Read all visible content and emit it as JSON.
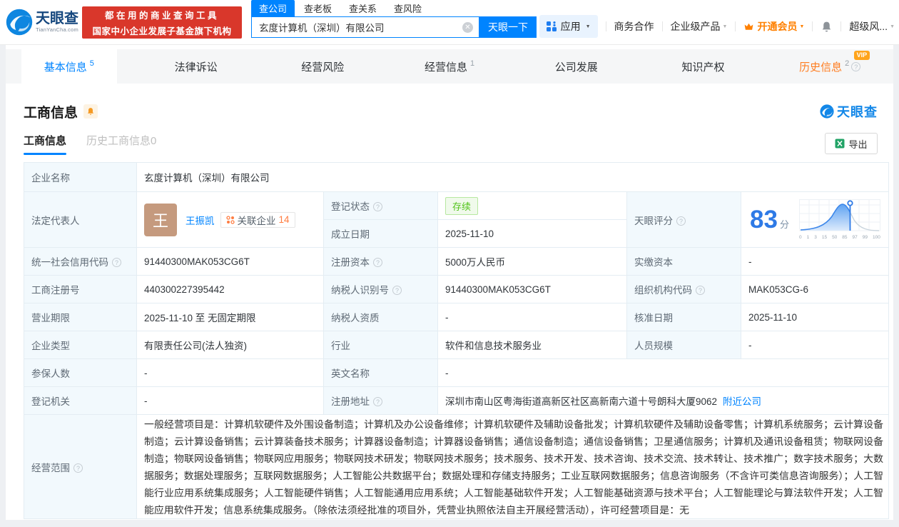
{
  "header": {
    "logo_title": "天眼查",
    "logo_domain": "TianYanCha.com",
    "banner_line1": "都在用的商业查询工具",
    "banner_line2": "国家中小企业发展子基金旗下机构",
    "search": {
      "tabs": [
        {
          "label": "查公司"
        },
        {
          "label": "查老板"
        },
        {
          "label": "查关系"
        },
        {
          "label": "查风险"
        }
      ],
      "value": "玄度计算机（深圳）有限公司",
      "button": "天眼一下"
    },
    "nav": {
      "apps": "应用",
      "cooperation": "商务合作",
      "enterprise": "企业级产品",
      "member": "开通会员",
      "super_risk": "超级风..."
    }
  },
  "nav_tabs": [
    {
      "label": "基本信息",
      "count": "5"
    },
    {
      "label": "法律诉讼",
      "count": ""
    },
    {
      "label": "经营风险",
      "count": ""
    },
    {
      "label": "经营信息",
      "count": "1"
    },
    {
      "label": "公司发展",
      "count": ""
    },
    {
      "label": "知识产权",
      "count": ""
    },
    {
      "label": "历史信息",
      "count": "2",
      "badge": "VIP"
    }
  ],
  "section": {
    "title": "工商信息",
    "watermark": "天眼查",
    "tab_current": "工商信息",
    "tab_history": "历史工商信息0",
    "export_label": "导出"
  },
  "table": {
    "company_name_label": "企业名称",
    "company_name": "玄度计算机（深圳）有限公司",
    "legal_rep_label": "法定代表人",
    "legal_rep_avatar": "王",
    "legal_rep_name": "王振凯",
    "related_label": "关联企业",
    "related_count": "14",
    "reg_status_label": "登记状态",
    "reg_status": "存续",
    "established_label": "成立日期",
    "established": "2025-11-10",
    "score_label": "天眼评分",
    "score": "83",
    "score_unit": "分",
    "score_axis": [
      "0",
      "1",
      "3",
      "15",
      "50",
      "85",
      "97",
      "99",
      "100"
    ],
    "credit_code_label": "统一社会信用代码",
    "credit_code": "91440300MAK053CG6T",
    "reg_capital_label": "注册资本",
    "reg_capital": "5000万人民币",
    "paid_capital_label": "实缴资本",
    "paid_capital": "-",
    "reg_number_label": "工商注册号",
    "reg_number": "440300227395442",
    "taxpayer_id_label": "纳税人识别号",
    "taxpayer_id": "91440300MAK053CG6T",
    "org_code_label": "组织机构代码",
    "org_code": "MAK053CG-6",
    "business_term_label": "营业期限",
    "business_term": "2025-11-10 至 无固定期限",
    "taxpayer_quality_label": "纳税人资质",
    "taxpayer_quality": "-",
    "approval_date_label": "核准日期",
    "approval_date": "2025-11-10",
    "company_type_label": "企业类型",
    "company_type": "有限责任公司(法人独资)",
    "industry_label": "行业",
    "industry": "软件和信息技术服务业",
    "staff_size_label": "人员规模",
    "staff_size": "-",
    "insured_label": "参保人数",
    "insured": "-",
    "english_name_label": "英文名称",
    "english_name": "-",
    "reg_authority_label": "登记机关",
    "reg_authority": "-",
    "address_label": "注册地址",
    "address": "深圳市南山区粤海街道高新区社区高新南六道十号朗科大厦9062",
    "nearby_link": "附近公司",
    "scope_label": "经营范围",
    "scope": "一般经营项目是：计算机软硬件及外围设备制造；计算机及办公设备维修；计算机软硬件及辅助设备批发；计算机软硬件及辅助设备零售；计算机系统服务；云计算设备制造；云计算设备销售；云计算装备技术服务；计算器设备制造；计算器设备销售；通信设备制造；通信设备销售；卫星通信服务；计算机及通讯设备租赁；物联网设备制造；物联网设备销售；物联网应用服务；物联网技术研发；物联网技术服务；技术服务、技术开发、技术咨询、技术交流、技术转让、技术推广；数字技术服务；大数据服务；数据处理服务；互联网数据服务；人工智能公共数据平台；数据处理和存储支持服务；工业互联网数据服务；信息咨询服务（不含许可类信息咨询服务）；人工智能行业应用系统集成服务；人工智能硬件销售；人工智能通用应用系统；人工智能基础软件开发；人工智能基础资源与技术平台；人工智能理论与算法软件开发；人工智能应用软件开发；信息系统集成服务。（除依法须经批准的项目外，凭营业执照依法自主开展经营活动），许可经营项目是：无"
  }
}
